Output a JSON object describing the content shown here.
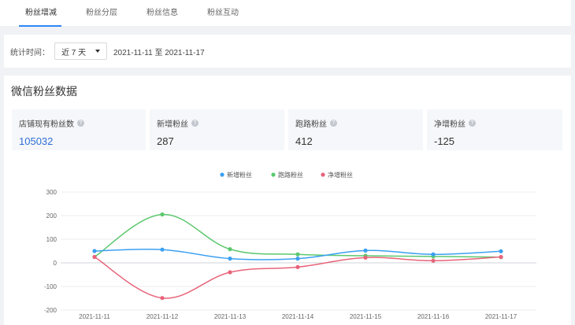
{
  "tabs": [
    "粉丝增减",
    "粉丝分层",
    "粉丝信息",
    "粉丝互动"
  ],
  "filter": {
    "label": "统计时间：",
    "select_value": "近 7 天",
    "date_range": "2021-11-11 至 2021-11-17"
  },
  "panel": {
    "title": "微信粉丝数据"
  },
  "stats": [
    {
      "label": "店铺现有粉丝数",
      "value": "105032",
      "help": "?"
    },
    {
      "label": "新增粉丝",
      "value": "287",
      "help": "?"
    },
    {
      "label": "跑路粉丝",
      "value": "412",
      "help": "?"
    },
    {
      "label": "净增粉丝",
      "value": "-125",
      "help": "?"
    }
  ],
  "colors": {
    "accent": "#2f86f6",
    "new": "#3ba0f2",
    "lost": "#5cc86e",
    "net": "#e8647a"
  },
  "chart_data": {
    "type": "line",
    "categories": [
      "2021-11-11",
      "2021-11-12",
      "2021-11-13",
      "2021-11-14",
      "2021-11-15",
      "2021-11-16",
      "2021-11-17"
    ],
    "series": [
      {
        "name": "新增粉丝",
        "values": [
          50,
          56,
          18,
          18,
          52,
          36,
          49
        ]
      },
      {
        "name": "跑路粉丝",
        "values": [
          25,
          205,
          58,
          36,
          30,
          27,
          24
        ]
      },
      {
        "name": "净增粉丝",
        "values": [
          25,
          -149,
          -40,
          -18,
          22,
          9,
          25
        ]
      }
    ],
    "yticks": [
      300,
      200,
      100,
      0,
      -100,
      -200
    ],
    "ylim": [
      -200,
      300
    ],
    "legend": "top-center",
    "smooth": true
  }
}
